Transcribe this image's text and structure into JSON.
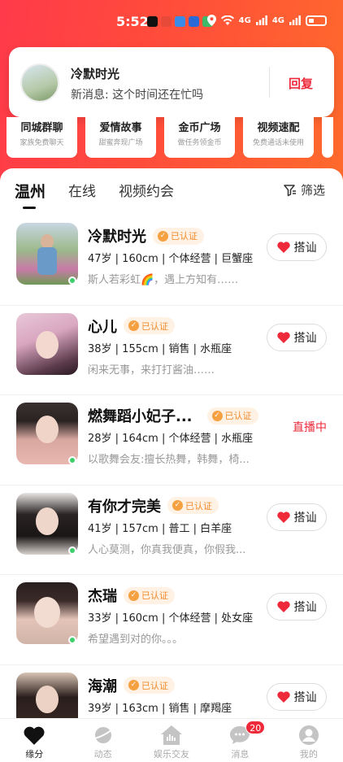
{
  "status_bar": {
    "time": "5:52",
    "signal_1": "4G",
    "signal_2": "4G"
  },
  "notification": {
    "sender": "冷默时光",
    "message": "新消息: 这个时间还在忙吗",
    "reply_label": "回复"
  },
  "quick_entries": [
    {
      "title": "同城群聊",
      "subtitle": "家族免费聊天"
    },
    {
      "title": "爱情故事",
      "subtitle": "甜蜜奔现广场"
    },
    {
      "title": "金币广场",
      "subtitle": "做任务领金币"
    },
    {
      "title": "视频速配",
      "subtitle": "免费通话未使用"
    }
  ],
  "tabs": [
    {
      "label": "温州",
      "active": true
    },
    {
      "label": "在线",
      "active": false
    },
    {
      "label": "视频约会",
      "active": false
    }
  ],
  "filter_label": "筛选",
  "verified_label": "已认证",
  "greet_label": "搭讪",
  "users": [
    {
      "name": "冷默时光",
      "info": "47岁 | 160cm | 个体经营 | 巨蟹座",
      "desc": "斯人若彩虹🌈，遇上方知有……",
      "verified": true,
      "online": true,
      "action": "搭讪"
    },
    {
      "name": "心儿",
      "info": "38岁 | 155cm | 销售 | 水瓶座",
      "desc": "闲来无事，来打打酱油……",
      "verified": true,
      "online": false,
      "action": "搭讪"
    },
    {
      "name": "燃舞蹈小妃子...",
      "info": "28岁 | 164cm | 个体经营 | 水瓶座",
      "desc": "以歌舞会友:擅长热舞，韩舞，椅...",
      "verified": true,
      "online": true,
      "action": "直播中"
    },
    {
      "name": "有你才完美",
      "info": "41岁 | 157cm | 普工 | 白羊座",
      "desc": "人心莫测，你真我便真，你假我...",
      "verified": true,
      "online": true,
      "action": "搭讪"
    },
    {
      "name": "杰瑞",
      "info": "33岁 | 160cm | 个体经营 | 处女座",
      "desc": "希望遇到对的你。。。",
      "verified": true,
      "online": true,
      "action": "搭讪"
    },
    {
      "name": "海潮",
      "info": "39岁 | 163cm | 销售 | 摩羯座",
      "desc": "",
      "verified": true,
      "online": false,
      "action": "搭讪"
    }
  ],
  "bottom_nav": [
    {
      "label": "缘分",
      "icon": "heart-icon",
      "active": true
    },
    {
      "label": "动态",
      "icon": "planet-icon",
      "active": false
    },
    {
      "label": "娱乐交友",
      "icon": "house-icon",
      "active": false
    },
    {
      "label": "消息",
      "icon": "chat-icon",
      "active": false,
      "badge": "20"
    },
    {
      "label": "我的",
      "icon": "profile-icon",
      "active": false
    }
  ],
  "colors": {
    "brand_red": "#ee2a3a",
    "header_gradient_start": "#ff3a4a",
    "header_gradient_end": "#ff6a2c",
    "verified_orange": "#f08a2a",
    "online_green": "#3ccf6a"
  }
}
